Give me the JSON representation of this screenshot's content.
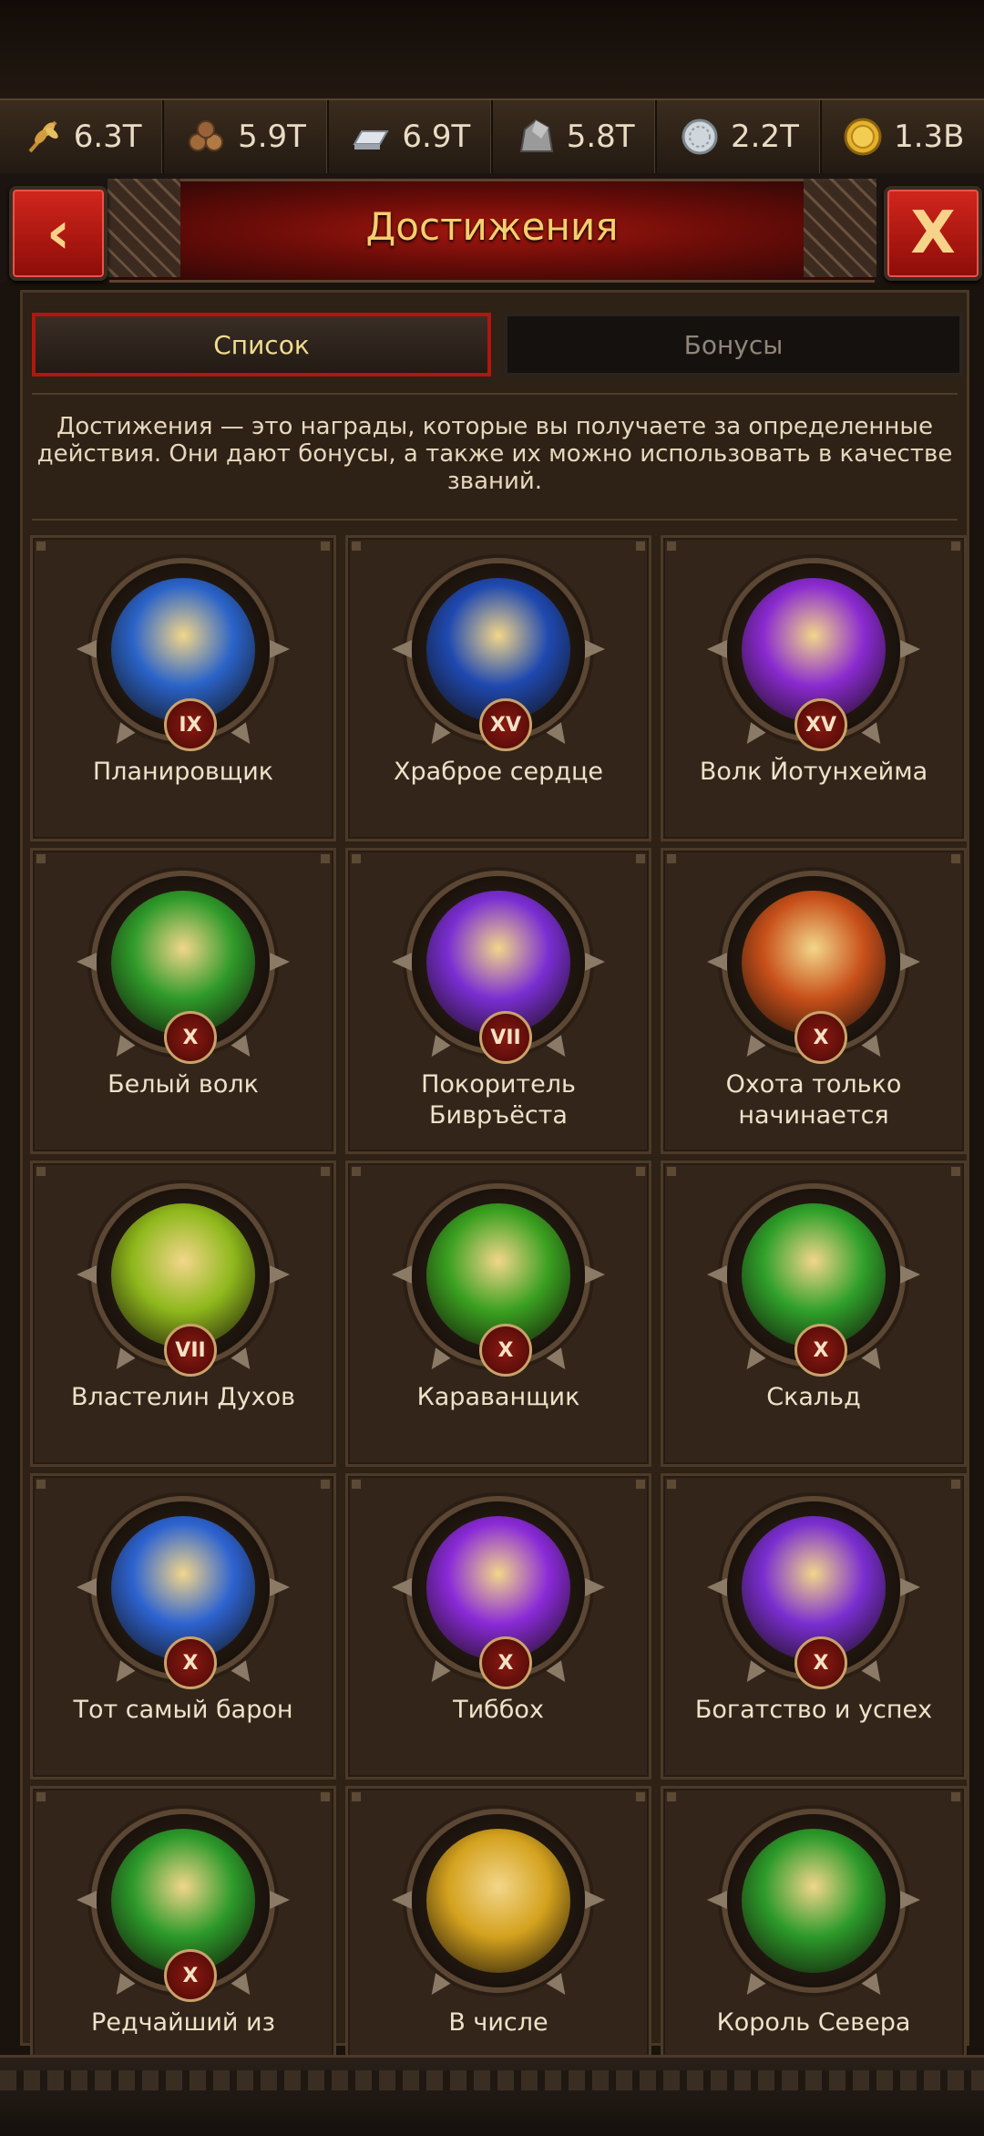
{
  "resources": [
    {
      "name": "wheat",
      "value": "6.3T",
      "icon": "wheat-icon",
      "color": "#d8a84a"
    },
    {
      "name": "wood",
      "value": "5.9T",
      "icon": "logs-icon",
      "color": "#9a6a3c"
    },
    {
      "name": "iron",
      "value": "6.9T",
      "icon": "ingot-icon",
      "color": "#c9cfd6"
    },
    {
      "name": "stone",
      "value": "5.8T",
      "icon": "stone-icon",
      "color": "#8e8e8e"
    },
    {
      "name": "silver",
      "value": "2.2T",
      "icon": "silver-coin-icon",
      "color": "#c9d2d8"
    },
    {
      "name": "gold",
      "value": "1.3B",
      "icon": "gold-coin-icon",
      "color": "#e2b02e"
    }
  ],
  "header": {
    "title": "Достижения",
    "back_icon": "chevron-left-icon",
    "close_icon": "close-icon"
  },
  "tabs": {
    "list": "Список",
    "bonuses": "Бонусы"
  },
  "description": "Достижения — это награды, которые вы получаете за определенные действия. Они дают бонусы, а также их можно использовать в качестве званий.",
  "achievements": [
    {
      "label": "Планировщик",
      "rank": "IX",
      "icon": "blueprint-icon",
      "bg": "#2a63c8"
    },
    {
      "label": "Храброе сердце",
      "rank": "XV",
      "icon": "armor-icon",
      "bg": "#1f49b0"
    },
    {
      "label": "Волк Йотунхейма",
      "rank": "XV",
      "icon": "banner-axe-icon",
      "bg": "#8a2ad0"
    },
    {
      "label": "Белый волк",
      "rank": "X",
      "icon": "gold-sack-icon",
      "bg": "#2f9a2a"
    },
    {
      "label": "Покоритель Бивръёста",
      "rank": "VII",
      "icon": "rainbow-bridge-icon",
      "bg": "#7a2ed2"
    },
    {
      "label": "Охота только начинается",
      "rank": "X",
      "icon": "hooded-figure-icon",
      "bg": "#c8501a"
    },
    {
      "label": "Властелин Духов",
      "rank": "VII",
      "icon": "spirit-orbs-icon",
      "bg": "#8fb81c"
    },
    {
      "label": "Караванщик",
      "rank": "X",
      "icon": "caravan-icon",
      "bg": "#3aa020"
    },
    {
      "label": "Скальд",
      "rank": "X",
      "icon": "masks-icon",
      "bg": "#2fa02a"
    },
    {
      "label": "Тот самый барон",
      "rank": "X",
      "icon": "hat-icon",
      "bg": "#2d63d0"
    },
    {
      "label": "Тиббох",
      "rank": "X",
      "icon": "eye-icon",
      "bg": "#8a2ad8"
    },
    {
      "label": "Богатство и успех",
      "rank": "X",
      "icon": "cart-icon",
      "bg": "#7a2ed0"
    },
    {
      "label": "Редчайший из",
      "rank": "X",
      "icon": "idol-icon",
      "bg": "#2c9a2a"
    },
    {
      "label": "В числе",
      "rank": "",
      "icon": "castle-icon",
      "bg": "#d4a21e"
    },
    {
      "label": "Король Севера",
      "rank": "",
      "icon": "helmet-book-icon",
      "bg": "#2c9a2a"
    }
  ]
}
